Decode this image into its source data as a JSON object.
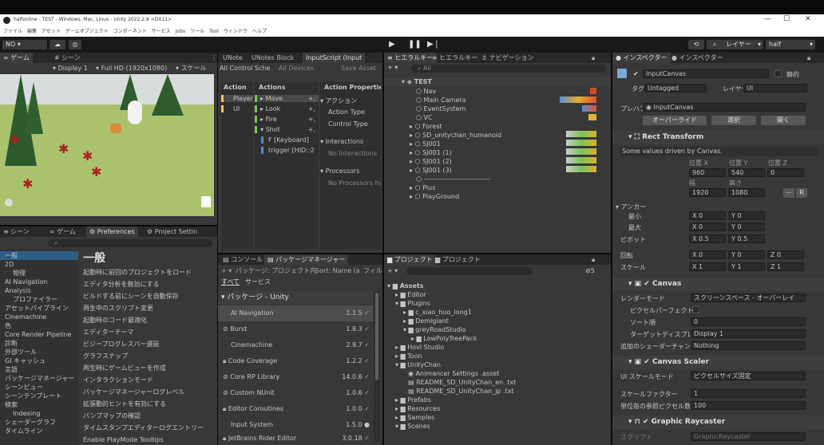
{
  "window": {
    "title": "haltonline - TEST - Windows, Mac, Linux - Unity 2022.2.8 <DX11>",
    "min": "—",
    "max": "☐",
    "close": "✕"
  },
  "menu": [
    "ファイル",
    "編集",
    "アセット",
    "ゲームオブジェクト",
    "コンポーネント",
    "サービス",
    "Jobs",
    "ツール",
    "Tool",
    "ウィンドウ",
    "ヘルプ"
  ],
  "toolbar": {
    "account": "NO ▾",
    "layers": "レイヤー",
    "layout": "half"
  },
  "game": {
    "tabs": [
      "ゲーム",
      "シーン"
    ],
    "display": "Display 1",
    "resolution": "Full HD (1920x1080)",
    "scale": "スケール"
  },
  "inputsys": {
    "tabs": [
      "UNote",
      "UNotes Block",
      "InputScript (Input"
    ],
    "scheme": "All Control Sche",
    "devices": "All Devices",
    "save": "Save Asset",
    "col_maps": "Action",
    "col_actions": "Actions",
    "col_props": "Action Properties",
    "maps": [
      "Player",
      "UI"
    ],
    "actions": [
      "Move",
      "Look",
      "Fire",
      "Shot"
    ],
    "bindings": [
      "F [Keyboard]",
      "trigger [HID::2"
    ],
    "prop_action": "アクション",
    "action_type": "Action Type",
    "control_type": "Control Type",
    "interactions": "Interactions",
    "no_interactions": "No Interactions",
    "processors": "Processors",
    "no_processors": "No Processors ha"
  },
  "hierarchy": {
    "tabs": [
      "ヒエラルキー",
      "ヒエラルキー",
      "ナビゲーション"
    ],
    "search": "All",
    "scene": "TEST",
    "items": [
      "Nav",
      "Main Camera",
      "EventSystem",
      "VC",
      "Forest",
      "SD_unitychan_humanoid",
      "SJ001",
      "SJ001 (1)",
      "SJ001 (2)",
      "SJ001 (3)",
      "-----------------------------",
      "Plus",
      "PlayGround"
    ]
  },
  "prefs": {
    "tabs": [
      "シーン",
      "ゲーム",
      "Preferences",
      "Project Settin"
    ],
    "title": "一般",
    "left": [
      "一般",
      "2D",
      "物理",
      "AI Navigation",
      "Analysis",
      "プロファイラー",
      "アセットパイプライン",
      "Cinemachine",
      "色",
      "Core Render Pipeline",
      "診断",
      "外部ツール",
      "GI キャッシュ",
      "言語",
      "パッケージマネージャー",
      "シーンビュー",
      "シーンテンプレート",
      "検索",
      "Indexing",
      "シェーダーグラフ",
      "タイムライン"
    ],
    "settings": [
      "起動時に前回のプロジェクトをロード",
      "エディタ分析を無効にする",
      "ビルドする前にシーンを自動保存",
      "再生中のスクリプト変更",
      "起動時のコード最適化",
      "エディターテーマ",
      "ビジープログレスバー遅延",
      "グラフスナップ",
      "再生時にゲームビューを作成",
      "インタラクションモード",
      "パッケージマネージャーログレベル",
      "拡張動的ヒントを有効にする",
      "バンプマップの確認",
      "タイムスタンプエディターログエントリー",
      "Enable PlayMode Tooltips"
    ]
  },
  "packages": {
    "tabs": [
      "コンソール",
      "パッケージマネージャー"
    ],
    "filter": "パッケージ: プロジェクト内",
    "sort": "Sort: Name (a",
    "filters": "フィルタ",
    "all": "すべて",
    "services": "サービス",
    "section": "パッケージ - Unity",
    "items": [
      {
        "name": "AI Navigation",
        "ver": "1.1.5"
      },
      {
        "name": "Burst",
        "ver": "1.8.3"
      },
      {
        "name": "Cinemachine",
        "ver": "2.9.7"
      },
      {
        "name": "Code Coverage",
        "ver": "1.2.2"
      },
      {
        "name": "Core RP Library",
        "ver": "14.0.6"
      },
      {
        "name": "Custom NUnit",
        "ver": "1.0.6"
      },
      {
        "name": "Editor Coroutines",
        "ver": "1.0.0"
      },
      {
        "name": "Input System",
        "ver": "1.5.0"
      },
      {
        "name": "JetBrains Rider Editor",
        "ver": "3.0.18"
      }
    ]
  },
  "project": {
    "tabs": [
      "プロジェクト",
      "プロジェクト"
    ],
    "count": "5",
    "tree": [
      {
        "label": "Assets",
        "d": 0
      },
      {
        "label": "Editor",
        "d": 1
      },
      {
        "label": "Plugins",
        "d": 1
      },
      {
        "label": "c_xiao_huo_long1",
        "d": 2
      },
      {
        "label": "Demigiant",
        "d": 2
      },
      {
        "label": "greyRoadStudio",
        "d": 2
      },
      {
        "label": "LowPolyTreePack",
        "d": 3
      },
      {
        "label": "Hovl Studio",
        "d": 1
      },
      {
        "label": "Toon",
        "d": 1
      },
      {
        "label": "UnityChan",
        "d": 1
      },
      {
        "label": "Animancer Settings    .asset",
        "d": 2
      },
      {
        "label": "README_SD_UnityChan_en    .txt",
        "d": 2
      },
      {
        "label": "README_SD_UnityChan_jp    .txt",
        "d": 2
      },
      {
        "label": "Prefabs",
        "d": 1
      },
      {
        "label": "Resources",
        "d": 1
      },
      {
        "label": "Samples",
        "d": 1
      },
      {
        "label": "Scenes",
        "d": 1
      }
    ]
  },
  "inspector": {
    "tabs": [
      "インスペクター",
      "インスペクター"
    ],
    "name": "InputCanvas",
    "static": "静的",
    "tag_label": "タグ",
    "tag": "Untagged",
    "layer_label": "レイヤー",
    "layer": "UI",
    "prefab_label": "プレハブ",
    "prefab": "InputCanvas",
    "overrides": "オーバーライド",
    "select": "選択",
    "open": "開く",
    "rect": {
      "title": "Rect Transform",
      "note": "Some values driven by Canvas.",
      "pos_labels": [
        "位置 X",
        "位置 Y",
        "位置 Z"
      ],
      "pos": [
        "960",
        "540",
        "0"
      ],
      "size_labels": [
        "幅",
        "高さ"
      ],
      "size": [
        "1920",
        "1080"
      ],
      "anchor": "アンカー",
      "min": "最小",
      "max": "最大",
      "pivot": "ピボット",
      "rotation": "回転",
      "scale": "スケール",
      "amin": [
        "0",
        "0"
      ],
      "amax": [
        "0",
        "0"
      ],
      "piv": [
        "0.5",
        "0.5"
      ],
      "rot": [
        "0",
        "0",
        "0"
      ],
      "scl": [
        "1",
        "1",
        "1"
      ]
    },
    "canvas": {
      "title": "Canvas",
      "render_mode_label": "レンダーモード",
      "render_mode": "スクリーンスペース - オーバーレイ",
      "pixel_perfect": "ピクセルパーフェクト",
      "sort_order_label": "ソート順",
      "sort_order": "0",
      "target_display_label": "ターゲットディスプレイ",
      "target_display": "Display 1",
      "shader_ch_label": "追加のシェーダーチャンネル",
      "shader_ch": "Nothing"
    },
    "scaler": {
      "title": "Canvas Scaler",
      "ui_scale_label": "UI スケールモード",
      "ui_scale": "ピクセルサイズ固定",
      "scale_factor_label": "スケールファクター",
      "scale_factor": "1",
      "ref_ppu_label": "単位毎の参照ピクセル数",
      "ref_ppu": "100"
    },
    "raycaster": {
      "title": "Graphic Raycaster",
      "script_label": "スクリプト",
      "script": "GraphicRaycaster"
    }
  },
  "colors": {
    "panel": "#383838",
    "dark": "#191919",
    "accent": "#2c5d87",
    "checkmark": "#79c25a"
  }
}
